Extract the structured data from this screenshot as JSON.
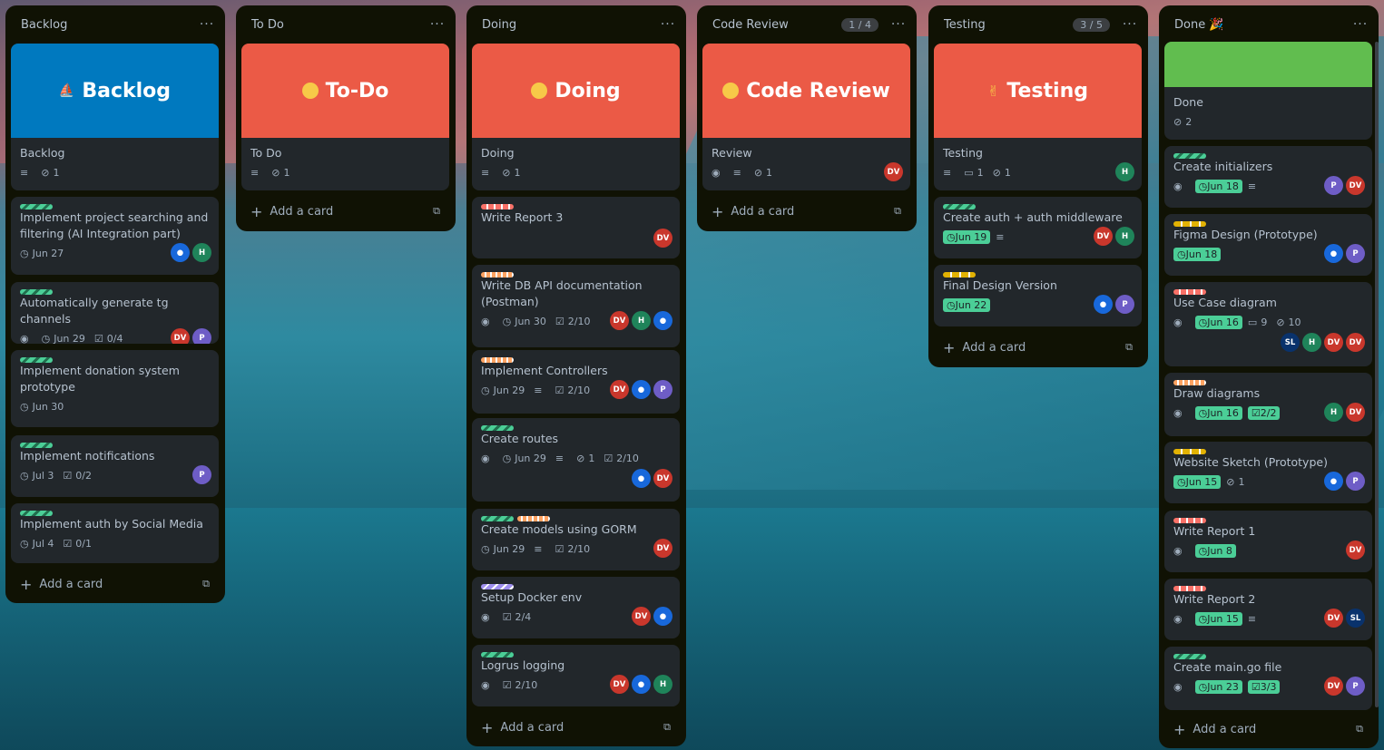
{
  "colors": {
    "green": "#4bce97",
    "red": "#f87168",
    "blue": "#0079bf",
    "coral": "#eb5a46",
    "limegreen": "#61bd4f",
    "list_bg": "#101204",
    "card_bg": "#22272b"
  },
  "lists": [
    {
      "title": "Backlog",
      "cover_title": "Backlog",
      "cover_text": "Backlog",
      "attach": "1",
      "cards": [
        {
          "text": "Implement project searching and filtering (AI Integration part)",
          "due": "Jun 27"
        },
        {
          "text": "Automatically generate tg channels",
          "due": "Jun 29",
          "check": "0/4"
        },
        {
          "text": "Implement donation system prototype",
          "due": "Jun 30"
        },
        {
          "text": "Implement notifications",
          "due": "Jul 3",
          "check": "0/2"
        },
        {
          "text": "Implement auth by Social Media",
          "due": "Jul 4",
          "check": "0/1"
        }
      ],
      "add": "Add a card"
    },
    {
      "title": "To Do",
      "cover_title": "To-Do",
      "cover_text": "To Do",
      "attach": "1",
      "add": "Add a card"
    },
    {
      "title": "Doing",
      "cover_title": "Doing",
      "cover_text": "Doing",
      "attach": "1",
      "cards": [
        {
          "text": "Write Report 3"
        },
        {
          "text": "Write DB API documentation (Postman)",
          "due": "Jun 30",
          "check": "2/10"
        },
        {
          "text": "Implement Controllers",
          "due": "Jun 29",
          "check": "2/10"
        },
        {
          "text": "Create routes",
          "due": "Jun 29",
          "attach": "1",
          "check": "2/10"
        },
        {
          "text": "Create models using GORM",
          "due": "Jun 29",
          "check": "2/10"
        },
        {
          "text": "Setup Docker env",
          "check": "2/4"
        },
        {
          "text": "Logrus logging",
          "check": "2/10"
        }
      ],
      "add": "Add a card"
    },
    {
      "title": "Code Review",
      "count": "1 / 4",
      "cover_title": "Code Review",
      "cover_text": "Review",
      "attach": "1",
      "add": "Add a card"
    },
    {
      "title": "Testing",
      "count": "3 / 5",
      "cover_title": "Testing",
      "cover_text": "Testing",
      "comments": "1",
      "attach": "1",
      "cards": [
        {
          "text": "Create auth + auth middleware",
          "due": "Jun 19"
        },
        {
          "text": "Final Design Version",
          "due": "Jun 22"
        }
      ],
      "add": "Add a card"
    },
    {
      "title": "Done 🎉",
      "cover_text": "Done",
      "attach": "2",
      "cards": [
        {
          "text": "Create initializers",
          "due": "Jun 18"
        },
        {
          "text": "Figma Design (Prototype)",
          "due": "Jun 18"
        },
        {
          "text": "Use Case diagram",
          "due": "Jun 16",
          "comments": "9",
          "attach": "10"
        },
        {
          "text": "Draw diagrams",
          "due": "Jun 16",
          "check": "2/2"
        },
        {
          "text": "Website Sketch (Prototype)",
          "due": "Jun 15",
          "attach": "1"
        },
        {
          "text": "Write Report 1",
          "due": "Jun 8"
        },
        {
          "text": "Write Report 2",
          "due": "Jun 15"
        },
        {
          "text": "Create main.go file",
          "due": "Jun 23",
          "check": "3/3"
        }
      ],
      "add": "Add a card"
    }
  ],
  "avatars": {
    "dv": "DV",
    "h": "H",
    "p": "P",
    "sl": "SL"
  },
  "menu": "···"
}
